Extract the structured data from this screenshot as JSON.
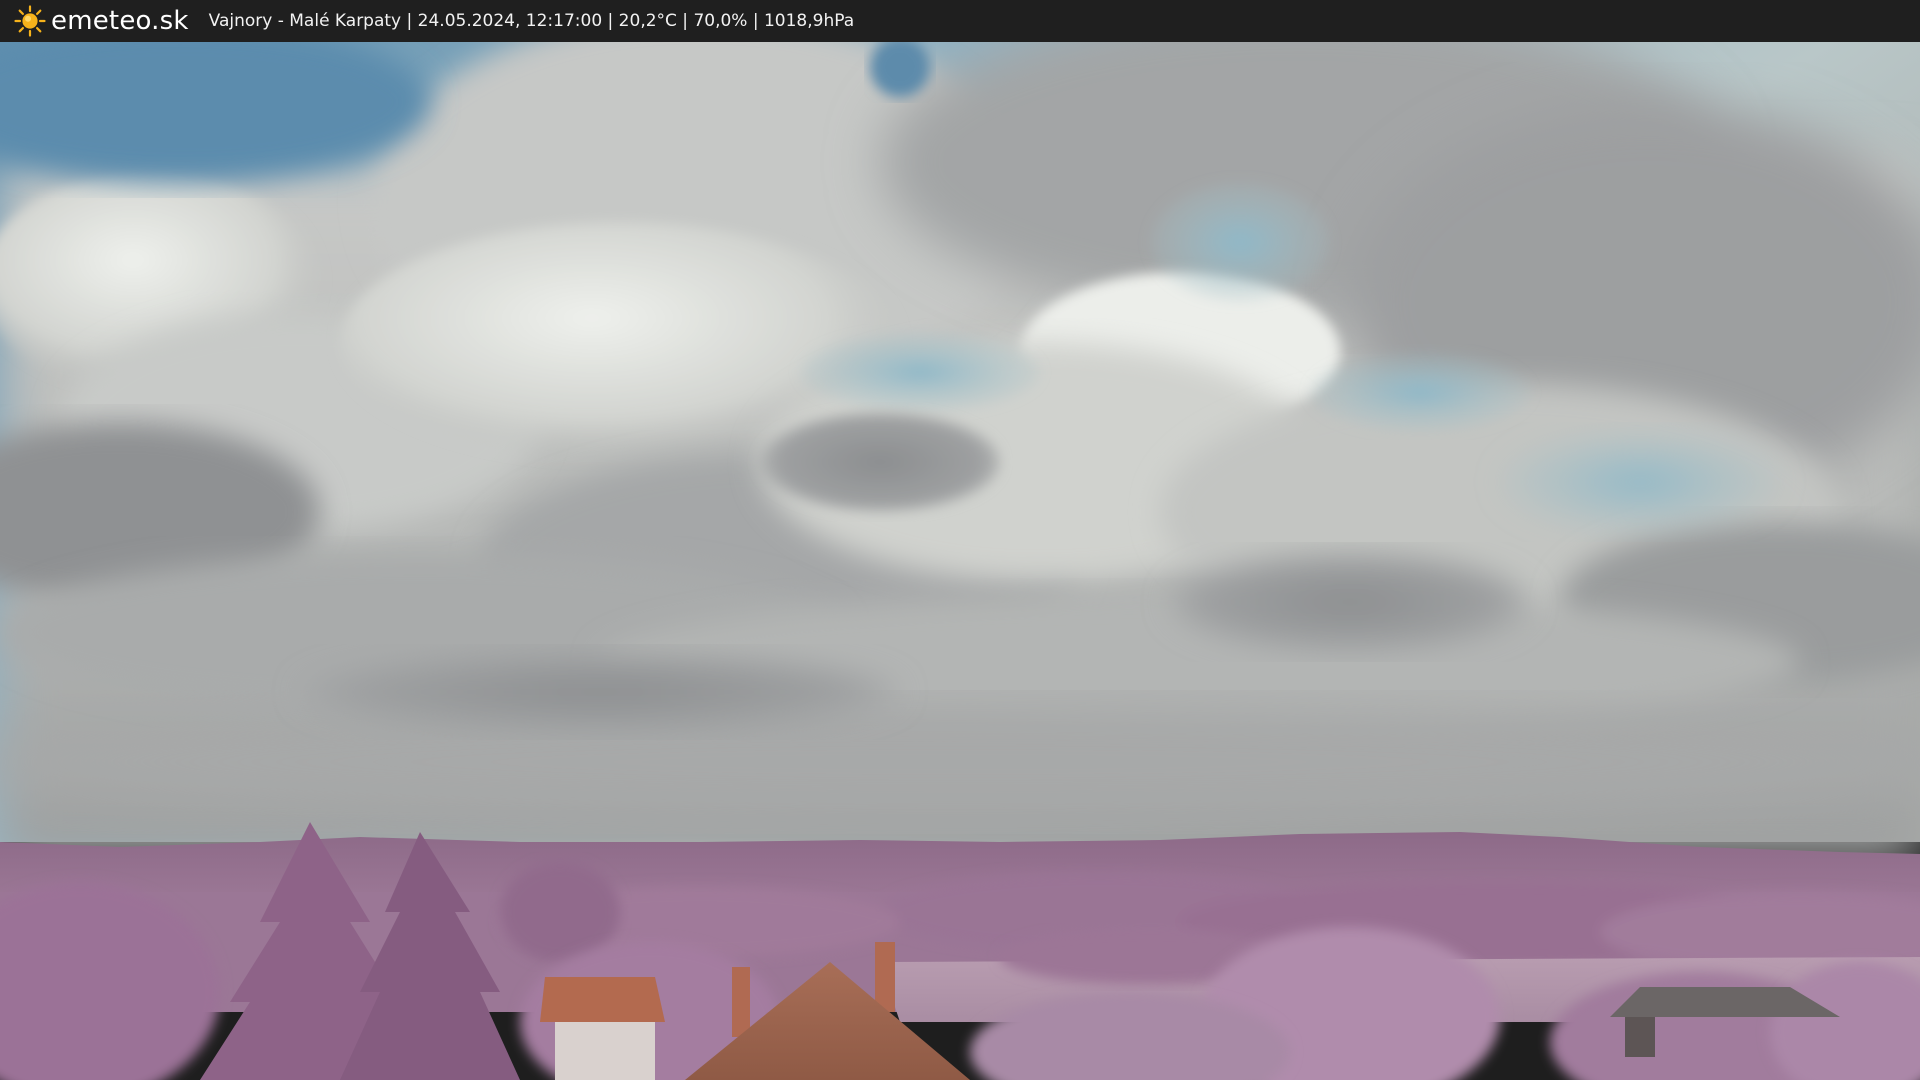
{
  "header": {
    "logo_icon": "sun-icon",
    "brand": "emeteo.sk",
    "caption": "Vajnory - Malé Karpaty | 24.05.2024, 12:17:00 | 20,2°C | 70,0% | 1018,9hPa"
  },
  "colors": {
    "bar": "#1f1f1f",
    "sun": "#f6b21b",
    "sky": "#6f9bb6",
    "cloud": "#d7d8d5",
    "hills": "#8f6c8a",
    "trees": "#a17a9e",
    "roof": "#b86a4c"
  }
}
